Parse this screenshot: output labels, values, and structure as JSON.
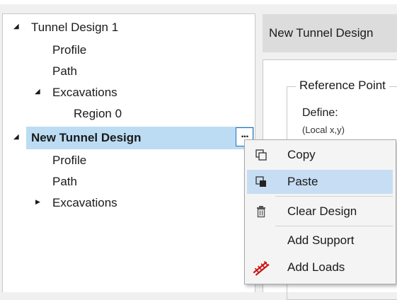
{
  "tree": {
    "nodes": [
      {
        "label": "Tunnel Design 1",
        "arrow": "◢"
      },
      {
        "label": "Profile"
      },
      {
        "label": "Path"
      },
      {
        "label": "Excavations",
        "arrow": "◢"
      },
      {
        "label": "Region 0"
      },
      {
        "label": "New Tunnel Design",
        "arrow": "◢"
      },
      {
        "label": "Profile"
      },
      {
        "label": "Path"
      },
      {
        "label": "Excavations",
        "arrow": "▶"
      }
    ],
    "more_label": "..."
  },
  "header": {
    "title": "New Tunnel Design"
  },
  "panel": {
    "group_title": "Reference Point",
    "define_label": "Define:",
    "local_label": "(Local x,y)"
  },
  "context_menu": {
    "items": [
      {
        "label": "Copy",
        "icon": "copy-icon"
      },
      {
        "label": "Paste",
        "icon": "paste-icon"
      },
      {
        "label": "Clear Design",
        "icon": "trash-icon"
      },
      {
        "label": "Add Support",
        "icon": ""
      },
      {
        "label": "Add Loads",
        "icon": "loads-icon"
      }
    ]
  },
  "colors": {
    "selection": "#bcdcf4",
    "menu_hover": "#c7ddf3",
    "loads_icon": "#cc1111",
    "focus_border": "#1f6fbf"
  }
}
